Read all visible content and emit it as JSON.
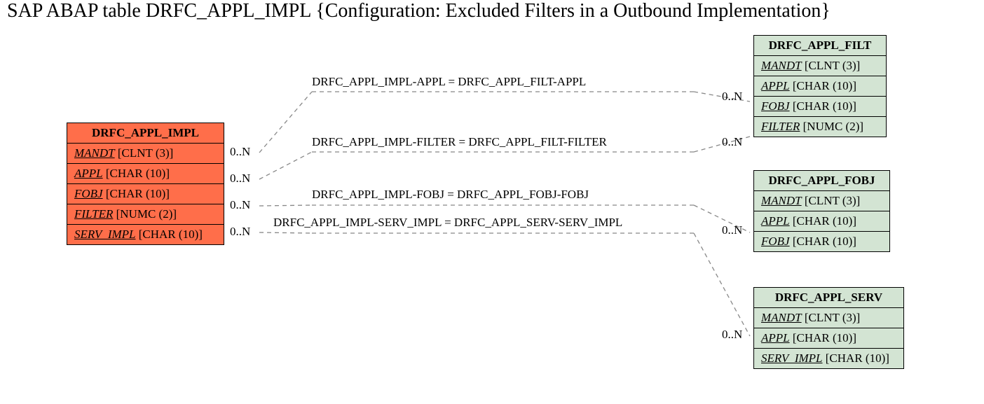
{
  "title": "SAP ABAP table DRFC_APPL_IMPL {Configuration: Excluded Filters in a Outbound Implementation}",
  "main": {
    "name": "DRFC_APPL_IMPL",
    "fields": [
      {
        "key": "MANDT",
        "type": "[CLNT (3)]"
      },
      {
        "key": "APPL",
        "type": "[CHAR (10)]"
      },
      {
        "key": "FOBJ",
        "type": "[CHAR (10)]"
      },
      {
        "key": "FILTER",
        "type": "[NUMC (2)]"
      },
      {
        "key": "SERV_IMPL",
        "type": "[CHAR (10)]"
      }
    ]
  },
  "filt": {
    "name": "DRFC_APPL_FILT",
    "fields": [
      {
        "key": "MANDT",
        "type": "[CLNT (3)]"
      },
      {
        "key": "APPL",
        "type": "[CHAR (10)]"
      },
      {
        "key": "FOBJ",
        "type": "[CHAR (10)]"
      },
      {
        "key": "FILTER",
        "type": "[NUMC (2)]"
      }
    ]
  },
  "fobj": {
    "name": "DRFC_APPL_FOBJ",
    "fields": [
      {
        "key": "MANDT",
        "type": "[CLNT (3)]"
      },
      {
        "key": "APPL",
        "type": "[CHAR (10)]"
      },
      {
        "key": "FOBJ",
        "type": "[CHAR (10)]"
      }
    ]
  },
  "serv": {
    "name": "DRFC_APPL_SERV",
    "fields": [
      {
        "key": "MANDT",
        "type": "[CLNT (3)]"
      },
      {
        "key": "APPL",
        "type": "[CHAR (10)]"
      },
      {
        "key": "SERV_IMPL",
        "type": "[CHAR (10)]"
      }
    ]
  },
  "rel": {
    "r1": "DRFC_APPL_IMPL-APPL = DRFC_APPL_FILT-APPL",
    "r2": "DRFC_APPL_IMPL-FILTER = DRFC_APPL_FILT-FILTER",
    "r3": "DRFC_APPL_IMPL-FOBJ = DRFC_APPL_FOBJ-FOBJ",
    "r4": "DRFC_APPL_IMPL-SERV_IMPL = DRFC_APPL_SERV-SERV_IMPL"
  },
  "card": {
    "zeroN": "0..N"
  },
  "chart_data": {
    "type": "table",
    "description": "Entity-relationship diagram for SAP ABAP table DRFC_APPL_IMPL and related tables",
    "entities": [
      {
        "name": "DRFC_APPL_IMPL",
        "role": "main",
        "color": "#ff6e4a",
        "fields": [
          {
            "name": "MANDT",
            "datatype": "CLNT",
            "length": 3,
            "key": true
          },
          {
            "name": "APPL",
            "datatype": "CHAR",
            "length": 10,
            "key": true
          },
          {
            "name": "FOBJ",
            "datatype": "CHAR",
            "length": 10,
            "key": true
          },
          {
            "name": "FILTER",
            "datatype": "NUMC",
            "length": 2,
            "key": true
          },
          {
            "name": "SERV_IMPL",
            "datatype": "CHAR",
            "length": 10,
            "key": true
          }
        ]
      },
      {
        "name": "DRFC_APPL_FILT",
        "role": "related",
        "color": "#d3e4d3",
        "fields": [
          {
            "name": "MANDT",
            "datatype": "CLNT",
            "length": 3,
            "key": true
          },
          {
            "name": "APPL",
            "datatype": "CHAR",
            "length": 10,
            "key": true
          },
          {
            "name": "FOBJ",
            "datatype": "CHAR",
            "length": 10,
            "key": true
          },
          {
            "name": "FILTER",
            "datatype": "NUMC",
            "length": 2,
            "key": true
          }
        ]
      },
      {
        "name": "DRFC_APPL_FOBJ",
        "role": "related",
        "color": "#d3e4d3",
        "fields": [
          {
            "name": "MANDT",
            "datatype": "CLNT",
            "length": 3,
            "key": true
          },
          {
            "name": "APPL",
            "datatype": "CHAR",
            "length": 10,
            "key": true
          },
          {
            "name": "FOBJ",
            "datatype": "CHAR",
            "length": 10,
            "key": true
          }
        ]
      },
      {
        "name": "DRFC_APPL_SERV",
        "role": "related",
        "color": "#d3e4d3",
        "fields": [
          {
            "name": "MANDT",
            "datatype": "CLNT",
            "length": 3,
            "key": true
          },
          {
            "name": "APPL",
            "datatype": "CHAR",
            "length": 10,
            "key": true
          },
          {
            "name": "SERV_IMPL",
            "datatype": "CHAR",
            "length": 10,
            "key": true
          }
        ]
      }
    ],
    "relationships": [
      {
        "from": "DRFC_APPL_IMPL.APPL",
        "to": "DRFC_APPL_FILT.APPL",
        "from_card": "0..N",
        "to_card": "0..N"
      },
      {
        "from": "DRFC_APPL_IMPL.FILTER",
        "to": "DRFC_APPL_FILT.FILTER",
        "from_card": "0..N",
        "to_card": "0..N"
      },
      {
        "from": "DRFC_APPL_IMPL.FOBJ",
        "to": "DRFC_APPL_FOBJ.FOBJ",
        "from_card": "0..N",
        "to_card": "0..N"
      },
      {
        "from": "DRFC_APPL_IMPL.SERV_IMPL",
        "to": "DRFC_APPL_SERV.SERV_IMPL",
        "from_card": "0..N",
        "to_card": "0..N"
      }
    ]
  }
}
